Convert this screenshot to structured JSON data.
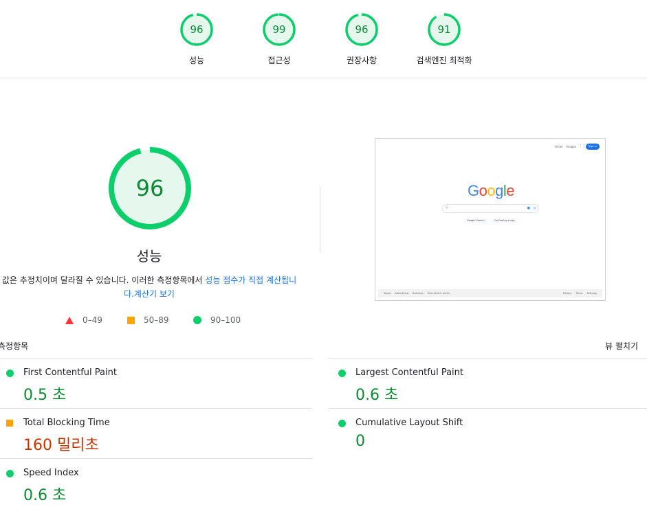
{
  "categories": [
    {
      "label": "성능",
      "score": "96",
      "fraction": 0.96
    },
    {
      "label": "접근성",
      "score": "99",
      "fraction": 0.99
    },
    {
      "label": "권장사항",
      "score": "96",
      "fraction": 0.96
    },
    {
      "label": "검색엔진 최적화",
      "score": "91",
      "fraction": 0.91
    }
  ],
  "main": {
    "score": "96",
    "fraction": 0.96,
    "title": "성능",
    "desc_text": "값은 추정치이며 달라질 수 있습니다. 이러한 측정항목에서 ",
    "desc_link1": "성능 점수가 직접 계산됩니다.",
    "desc_link2": "계산기 보기"
  },
  "legend": {
    "fail": "0–49",
    "average": "50–89",
    "pass": "90–100"
  },
  "screenshot": {
    "links": [
      "Gmail",
      "Images"
    ],
    "signin": "Sign in",
    "logo": "Google",
    "buttons": [
      "Google Search",
      "I'm Feeling Lucky"
    ],
    "footer_left": [
      "About",
      "Advertising",
      "Business",
      "How Search works"
    ],
    "footer_right": [
      "Privacy",
      "Terms",
      "Settings"
    ]
  },
  "metrics": {
    "heading": "측정항목",
    "expand": "뷰 펼치기",
    "fcp": {
      "name": "First Contentful Paint",
      "value": "0.5 초",
      "rating": "pass"
    },
    "lcp": {
      "name": "Largest Contentful Paint",
      "value": "0.6 초",
      "rating": "pass"
    },
    "tbt": {
      "name": "Total Blocking Time",
      "value": "160 밀리초",
      "rating": "average"
    },
    "cls": {
      "name": "Cumulative Layout Shift",
      "value": "0",
      "rating": "pass"
    },
    "si": {
      "name": "Speed Index",
      "value": "0.6 초",
      "rating": "pass"
    }
  },
  "colors": {
    "pass": "#0cce6b",
    "pass_text": "#0b8a33",
    "pass_bg": "#e6f8ee",
    "average": "#ffa400",
    "average_text": "#c33300",
    "fail": "#ff3333",
    "link": "#1a73e8"
  }
}
